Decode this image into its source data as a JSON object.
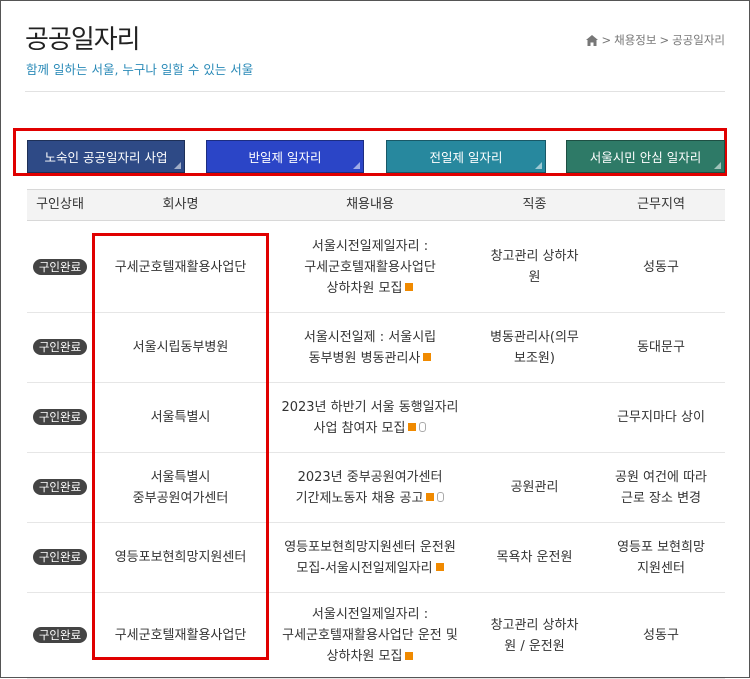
{
  "header": {
    "title": "공공일자리",
    "subtitle": "함께 일하는 서울, 누구나 일할 수 있는 서울",
    "breadcrumb": [
      "채용정보",
      "공공일자리"
    ],
    "breadcrumb_sep": ">"
  },
  "tabs": [
    {
      "label": "노숙인 공공일자리 사업",
      "color": "#2e4a86"
    },
    {
      "label": "반일제 일자리",
      "color": "#2b45c7"
    },
    {
      "label": "전일제 일자리",
      "color": "#27889e"
    },
    {
      "label": "서울시민 안심 일자리",
      "color": "#2e7a67"
    }
  ],
  "table": {
    "columns": [
      "구인상태",
      "회사명",
      "채용내용",
      "직종",
      "근무지역"
    ],
    "rows": [
      {
        "status": "구인완료",
        "company": "구세군호텔재활용사업단",
        "content": [
          "서울시전일제일자리 :",
          "구세군호텔재활용사업단",
          "상하차원 모집"
        ],
        "job": [
          "창고관리 상하차",
          "원"
        ],
        "area": [
          "성동구"
        ],
        "clip": false
      },
      {
        "status": "구인완료",
        "company": "서울시립동부병원",
        "content": [
          "서울시전일제 : 서울시립",
          "동부병원 병동관리사"
        ],
        "job": [
          "병동관리사(의무",
          "보조원)"
        ],
        "area": [
          "동대문구"
        ],
        "clip": false
      },
      {
        "status": "구인완료",
        "company": "서울특별시",
        "content": [
          "2023년 하반기 서울 동행일자리",
          "사업 참여자 모집"
        ],
        "job": [],
        "area": [
          "근무지마다 상이"
        ],
        "clip": true
      },
      {
        "status": "구인완료",
        "company": [
          "서울특별시",
          "중부공원여가센터"
        ],
        "content": [
          "2023년 중부공원여가센터",
          "기간제노동자 채용 공고"
        ],
        "job": [
          "공원관리"
        ],
        "area": [
          "공원 여건에 따라",
          "근로 장소 변경"
        ],
        "clip": true
      },
      {
        "status": "구인완료",
        "company": "영등포보현희망지원센터",
        "content": [
          "영등포보현희망지원센터 운전원",
          "모집-서울시전일제일자리"
        ],
        "job": [
          "목욕차 운전원"
        ],
        "area": [
          "영등포 보현희망",
          "지원센터"
        ],
        "clip": false
      },
      {
        "status": "구인완료",
        "company": "구세군호텔재활용사업단",
        "content": [
          "서울시전일제일자리 :",
          "구세군호텔재활용사업단 운전 및",
          "상하차원 모집"
        ],
        "job": [
          "창고관리 상하차",
          "원 / 운전원"
        ],
        "area": [
          "성동구"
        ],
        "clip": false
      }
    ]
  },
  "icons": {
    "home": "home-icon",
    "new": "new-icon",
    "attachment": "attachment-icon"
  },
  "highlight_color": "#e00000"
}
